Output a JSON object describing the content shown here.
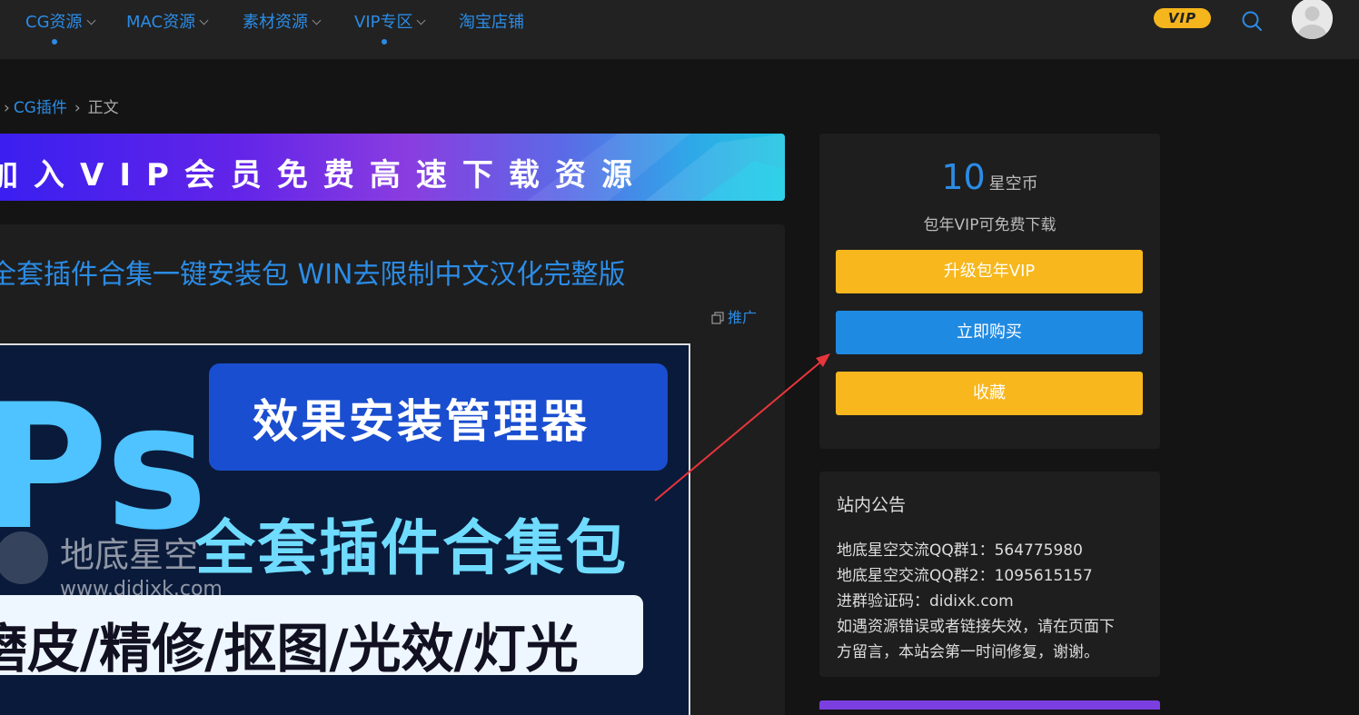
{
  "nav": {
    "items": [
      {
        "label": "CG资源",
        "has_dropdown": true,
        "active_dot": true
      },
      {
        "label": "MAC资源",
        "has_dropdown": true,
        "active_dot": false
      },
      {
        "label": "素材资源",
        "has_dropdown": true,
        "active_dot": false
      },
      {
        "label": "VIP专区",
        "has_dropdown": true,
        "active_dot": true
      },
      {
        "label": "淘宝店铺",
        "has_dropdown": false,
        "active_dot": false
      }
    ],
    "vip_badge": "VIP",
    "search_icon": "search-icon",
    "avatar_icon": "user-avatar"
  },
  "breadcrumb": {
    "category": "CG插件",
    "current": "正文"
  },
  "banner": {
    "text": "加入VIP会员免费高速下载资源"
  },
  "article": {
    "title": "全套插件合集一键安装包 WIN去限制中文汉化完整版",
    "promo_label": "推广",
    "cover": {
      "panel_text": "效果安装管理器",
      "ps_text": "Ps",
      "big_text": "全套插件合集包",
      "watermark_name": "地底星空",
      "watermark_url": "www.didixk.com",
      "strip_text": "磨皮/精修/抠图/光效/灯光"
    }
  },
  "purchase": {
    "price": "10",
    "unit": "星空币",
    "note": "包年VIP可免费下载",
    "upgrade_label": "升级包年VIP",
    "buy_label": "立即购买",
    "favorite_label": "收藏"
  },
  "notice": {
    "title": "站内公告",
    "lines": [
      "地底星空交流QQ群1：564775980",
      "地底星空交流QQ群2：1095615157",
      "进群验证码：didixk.com",
      "如遇资源错误或者链接失效，请在页面下",
      "方留言，本站会第一时间修复，谢谢。"
    ]
  },
  "colors": {
    "accent": "#2b8ce6",
    "vip_yellow": "#f7b71d",
    "background": "#141414",
    "card": "#1e1e1e",
    "annotation_arrow": "#e8353b"
  }
}
